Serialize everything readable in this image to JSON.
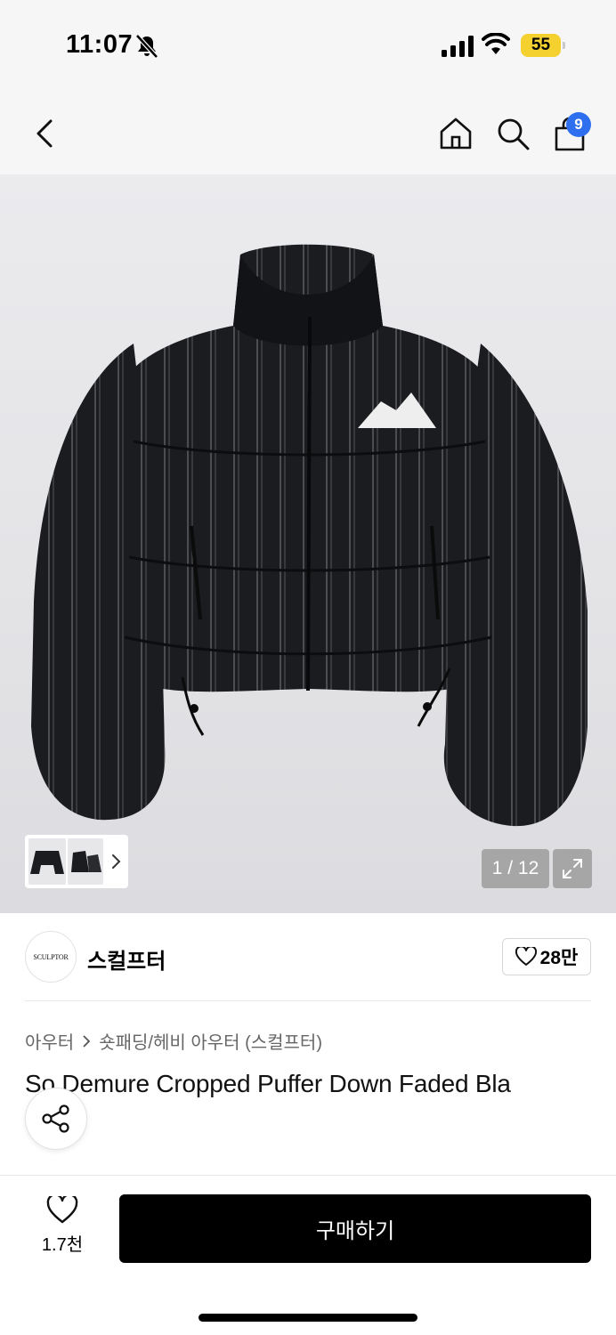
{
  "status_bar": {
    "time": "11:07",
    "battery": "55",
    "icons": [
      "bell-slash-icon",
      "signal-icon",
      "wifi-icon",
      "battery-icon"
    ]
  },
  "nav": {
    "icons": [
      "back-icon",
      "home-icon",
      "search-icon",
      "shopping-bag-icon"
    ],
    "cart_count": "9",
    "badge_color": "#2e6ff0"
  },
  "gallery": {
    "counter": "1 / 12",
    "icons": [
      "chevron-right-icon",
      "expand-icon"
    ]
  },
  "brand": {
    "logo_text": "SCULPTOR",
    "name": "스컬프터",
    "likes": "28만"
  },
  "product": {
    "breadcrumb": [
      "아우터",
      "숏패딩/헤비 아우터 (스컬프터)"
    ],
    "title": "So Demure Cropped Puffer Down Faded Bla"
  },
  "bottom": {
    "wish_count": "1.7천",
    "buy_label": "구매하기"
  }
}
